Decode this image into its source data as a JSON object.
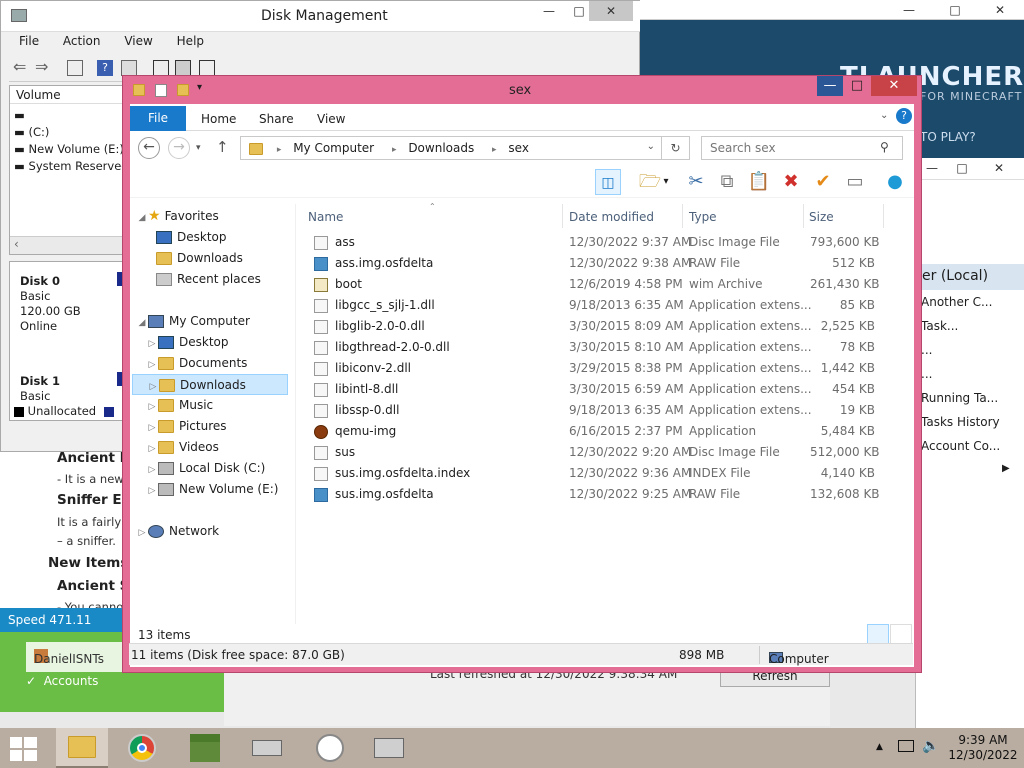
{
  "disk_management": {
    "title": "Disk Management",
    "menu": [
      "File",
      "Action",
      "View",
      "Help"
    ],
    "volume_header": "Volume",
    "volumes": [
      "",
      "(C:)",
      "New Volume (E:)",
      "System Reserved"
    ],
    "disk0": {
      "name": "Disk 0",
      "type": "Basic",
      "size": "120.00 GB",
      "status": "Online"
    },
    "disk1": {
      "name": "Disk 1",
      "type": "Basic"
    },
    "legend_unallocated": "Unallocated",
    "legend_p": "P"
  },
  "web_page": {
    "h1": "Ancient Pl",
    "p1": "- It is a new",
    "h2": "Sniffer Egg",
    "p2": "It is a fairly",
    "p3": "– a sniffer.",
    "h3": "New Items",
    "h4": "Ancient Se",
    "p4": "- You canno",
    "speed": "Speed 471.11"
  },
  "launcher_side": {
    "user": "DanielISNTs",
    "accounts": "Accounts"
  },
  "tlauncher": {
    "title": "TLAUNCHER",
    "subtitle": "FOR MINECRAFT",
    "question": "TO PLAY?"
  },
  "task_scheduler": {
    "header": "er (Local)",
    "items": [
      "Another C...",
      "Task...",
      "...",
      "...",
      "Running Ta...",
      "Tasks History",
      "Account Co..."
    ]
  },
  "bottom_panel": {
    "last_refreshed": "Last refreshed at 12/30/2022 9:38:34 AM",
    "refresh": "Refresh"
  },
  "explorer": {
    "title": "sex",
    "ribbon_tabs": [
      "File",
      "Home",
      "Share",
      "View"
    ],
    "breadcrumb": [
      "My Computer",
      "Downloads",
      "sex"
    ],
    "search_placeholder": "Search sex",
    "columns": {
      "name": "Name",
      "date": "Date modified",
      "type": "Type",
      "size": "Size"
    },
    "nav": {
      "favorites": "Favorites",
      "fav_items": [
        "Desktop",
        "Downloads",
        "Recent places"
      ],
      "computer": "My Computer",
      "comp_items": [
        "Desktop",
        "Documents",
        "Downloads",
        "Music",
        "Pictures",
        "Videos",
        "Local Disk (C:)",
        "New Volume (E:)"
      ],
      "network": "Network"
    },
    "files": [
      {
        "name": "ass",
        "date": "12/30/2022 9:37 AM",
        "type": "Disc Image File",
        "size": "793,600 KB",
        "icon": "disc-image-icon"
      },
      {
        "name": "ass.img.osfdelta",
        "date": "12/30/2022 9:38 AM",
        "type": "RAW File",
        "size": "512 KB",
        "icon": "raw-file-icon"
      },
      {
        "name": "boot",
        "date": "12/6/2019 4:58 PM",
        "type": "wim Archive",
        "size": "261,430 KB",
        "icon": "wim-archive-icon"
      },
      {
        "name": "libgcc_s_sjlj-1.dll",
        "date": "9/18/2013 6:35 AM",
        "type": "Application extens...",
        "size": "85 KB",
        "icon": "dll-icon"
      },
      {
        "name": "libglib-2.0-0.dll",
        "date": "3/30/2015 8:09 AM",
        "type": "Application extens...",
        "size": "2,525 KB",
        "icon": "dll-icon"
      },
      {
        "name": "libgthread-2.0-0.dll",
        "date": "3/30/2015 8:10 AM",
        "type": "Application extens...",
        "size": "78 KB",
        "icon": "dll-icon"
      },
      {
        "name": "libiconv-2.dll",
        "date": "3/29/2015 8:38 PM",
        "type": "Application extens...",
        "size": "1,442 KB",
        "icon": "dll-icon"
      },
      {
        "name": "libintl-8.dll",
        "date": "3/30/2015 6:59 AM",
        "type": "Application extens...",
        "size": "454 KB",
        "icon": "dll-icon"
      },
      {
        "name": "libssp-0.dll",
        "date": "9/18/2013 6:35 AM",
        "type": "Application extens...",
        "size": "19 KB",
        "icon": "dll-icon"
      },
      {
        "name": "qemu-img",
        "date": "6/16/2015 2:37 PM",
        "type": "Application",
        "size": "5,484 KB",
        "icon": "qemu-app-icon"
      },
      {
        "name": "sus",
        "date": "12/30/2022 9:20 AM",
        "type": "Disc Image File",
        "size": "512,000 KB",
        "icon": "disc-image-icon"
      },
      {
        "name": "sus.img.osfdelta.index",
        "date": "12/30/2022 9:36 AM",
        "type": "INDEX File",
        "size": "4,140 KB",
        "icon": "generic-file-icon"
      },
      {
        "name": "sus.img.osfdelta",
        "date": "12/30/2022 9:25 AM",
        "type": "RAW File",
        "size": "132,608 KB",
        "icon": "raw-file-icon"
      }
    ],
    "item_count": "13 items",
    "status": {
      "items": "11 items (Disk free space: 87.0 GB)",
      "size": "898 MB",
      "location": "Computer"
    }
  },
  "taskbar": {
    "time": "9:39 AM",
    "date": "12/30/2022"
  }
}
